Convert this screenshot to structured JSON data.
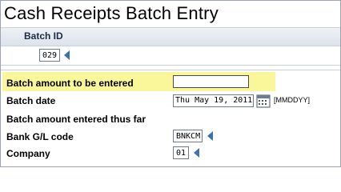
{
  "window": {
    "title": "Cash Receipts Batch Entry"
  },
  "header": {
    "batch_id_label": "Batch ID"
  },
  "batch": {
    "id_value": "029"
  },
  "form": {
    "batch_amount_label": "Batch amount to be entered",
    "batch_amount_value": "",
    "batch_date_label": "Batch date",
    "batch_date_value": "Thu May 19, 2011",
    "batch_date_format": "[MMDDYY]",
    "amount_entered_label": "Batch amount entered thus far",
    "bank_gl_label": "Bank G/L code",
    "bank_gl_value": "BNKCM",
    "company_label": "Company",
    "company_value": "01"
  },
  "colors": {
    "highlight": "#f9f79a",
    "prompt_arrow": "#3d6fb2"
  },
  "icons": {
    "prompt": "prompt-arrow-icon",
    "calendar": "calendar-icon"
  }
}
